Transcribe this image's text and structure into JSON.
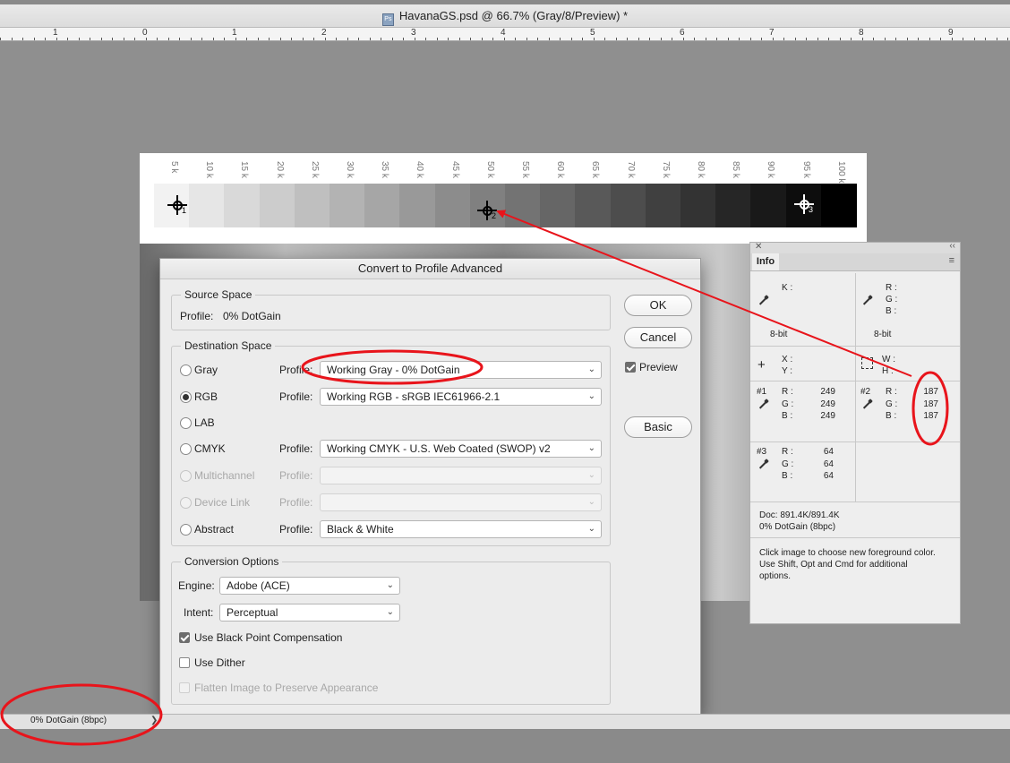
{
  "window": {
    "title": "HavanaGS.psd @ 66.7% (Gray/8/Preview) *",
    "app_icon": "Ps"
  },
  "ruler": {
    "labels": [
      "1",
      "0",
      "1",
      "2",
      "3",
      "4",
      "5",
      "6",
      "7",
      "8",
      "9"
    ]
  },
  "document": {
    "step_labels": [
      "5 k",
      "10 k",
      "15 k",
      "20 k",
      "25 k",
      "30 k",
      "35 k",
      "40 k",
      "45 k",
      "50 k",
      "55 k",
      "60 k",
      "65 k",
      "70 k",
      "75 k",
      "80 k",
      "85 k",
      "90 k",
      "95 k",
      "100 k"
    ],
    "samplers": [
      "1",
      "2",
      "3"
    ]
  },
  "dialog": {
    "title": "Convert to Profile Advanced",
    "source": {
      "legend": "Source Space",
      "profile_label": "Profile:",
      "profile_value": "0% DotGain"
    },
    "destination": {
      "legend": "Destination Space",
      "profile_label": "Profile:",
      "rows": [
        {
          "label": "Gray",
          "profile": "Working Gray - 0% DotGain"
        },
        {
          "label": "RGB",
          "profile": "Working RGB - sRGB IEC61966-2.1"
        },
        {
          "label": "LAB"
        },
        {
          "label": "CMYK",
          "profile": "Working CMYK - U.S. Web Coated (SWOP) v2"
        },
        {
          "label": "Multichannel",
          "profile": ""
        },
        {
          "label": "Device Link",
          "profile": ""
        },
        {
          "label": "Abstract",
          "profile": "Black & White"
        }
      ],
      "selected": "RGB"
    },
    "conversion": {
      "legend": "Conversion Options",
      "engine_label": "Engine:",
      "engine_value": "Adobe (ACE)",
      "intent_label": "Intent:",
      "intent_value": "Perceptual",
      "bpc_label": "Use Black Point Compensation",
      "bpc_checked": true,
      "dither_label": "Use Dither",
      "dither_checked": false,
      "flatten_label": "Flatten Image to Preserve Appearance",
      "flatten_checked": false
    },
    "buttons": {
      "ok": "OK",
      "cancel": "Cancel",
      "basic": "Basic"
    },
    "preview": {
      "label": "Preview",
      "checked": true
    }
  },
  "info_panel": {
    "tab": "Info",
    "k_label": "K :",
    "rgb_labels": {
      "r": "R :",
      "g": "G :",
      "b": "B :"
    },
    "bit_left": "8-bit",
    "bit_right": "8-bit",
    "xy": {
      "x": "X :",
      "y": "Y :"
    },
    "wh": {
      "w": "W :",
      "h": "H :"
    },
    "samplers": [
      {
        "id": "#1",
        "r": "249",
        "g": "249",
        "b": "249"
      },
      {
        "id": "#2",
        "r": "187",
        "g": "187",
        "b": "187"
      },
      {
        "id": "#3",
        "r": "64",
        "g": "64",
        "b": "64"
      }
    ],
    "doc": "Doc: 891.4K/891.4K",
    "doc_profile": "0% DotGain (8bpc)",
    "hint": "Click image to choose new foreground color.  Use Shift, Opt and Cmd for additional options."
  },
  "status": {
    "profile": "0% DotGain (8bpc)",
    "arrow": "❯"
  },
  "annotation_color": "#e8141b"
}
